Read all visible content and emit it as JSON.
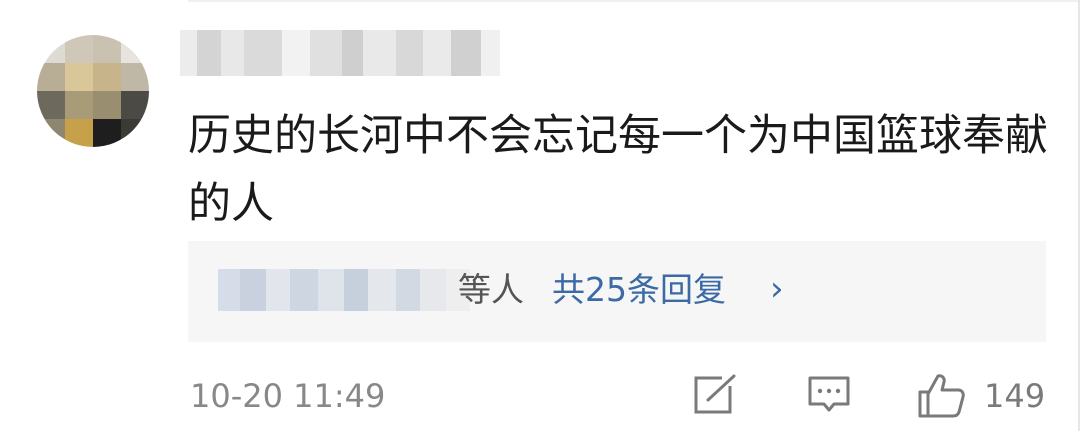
{
  "comment": {
    "text": "历史的长河中不会忘记每一个为中国篮球奉献的人",
    "timestamp": "10-20 11:49"
  },
  "replies": {
    "names_suffix": "等人",
    "count_label": "共25条回复",
    "chevron": "›"
  },
  "actions": {
    "share_icon": "edit-share-icon",
    "comment_icon": "speech-bubble-icon",
    "like_icon": "thumbs-up-icon",
    "like_count": "149"
  },
  "colors": {
    "reply_link": "#3b6aa5",
    "text": "#1a1a1a",
    "meta": "#888888",
    "reply_box_bg": "#f6f6f6"
  }
}
